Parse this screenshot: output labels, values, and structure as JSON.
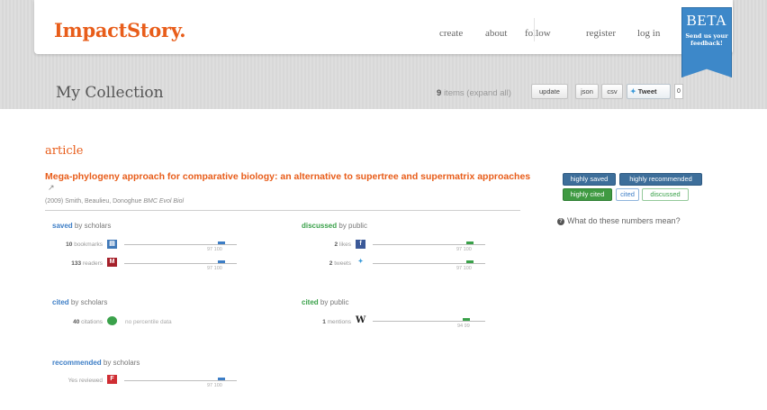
{
  "colors": {
    "accent": "#e85d1a",
    "scholars": "#3d7ec6",
    "public": "#3aa14a",
    "beta": "#3d88c9"
  },
  "header": {
    "logo": "ImpactStory.",
    "nav": [
      "create",
      "about",
      "follow",
      "register",
      "log in"
    ],
    "beta": {
      "title": "BETA",
      "line1": "Send us your",
      "line2": "feedback!"
    }
  },
  "collection": {
    "title": "My Collection",
    "count": "9",
    "count_suffix": "items (expand all)",
    "buttons": {
      "update": "update",
      "json": "json",
      "csv": "csv",
      "tweet": "Tweet",
      "tweet_count": "0"
    }
  },
  "section": "article",
  "article": {
    "title": "Mega-phylogeny approach for comparative biology: an alternative to supertree and supermatrix approaches",
    "year": "(2009)",
    "authors": "Smith, Beaulieu, Donoghue",
    "journal": "BMC Evol Biol"
  },
  "groups": {
    "saved_scholars": {
      "key": "saved",
      "by": "by scholars",
      "metrics": [
        {
          "value": "10",
          "label": "bookmarks",
          "icon": "citeulike-icon",
          "percentile": 97,
          "nums": "97  100"
        },
        {
          "value": "133",
          "label": "readers",
          "icon": "mendeley-icon",
          "percentile": 97,
          "nums": "97  100"
        }
      ]
    },
    "discussed_public": {
      "key": "discussed",
      "by": "by public",
      "metrics": [
        {
          "value": "2",
          "label": "likes",
          "icon": "facebook-icon",
          "percentile": 97,
          "nums": "97  100"
        },
        {
          "value": "2",
          "label": "tweets",
          "icon": "twitter-icon",
          "percentile": 97,
          "nums": "97  100"
        }
      ]
    },
    "cited_scholars": {
      "key": "cited",
      "by": "by scholars",
      "metrics": [
        {
          "value": "40",
          "label": "citations",
          "icon": "pubmed-central-icon",
          "note": "no percentile data"
        }
      ]
    },
    "cited_public": {
      "key": "cited",
      "by": "by public",
      "metrics": [
        {
          "value": "1",
          "label": "mentions",
          "icon": "wikipedia-icon",
          "percentile": 94,
          "nums": "94  99"
        }
      ]
    },
    "recommended_scholars": {
      "key": "recommended",
      "by": "by scholars",
      "metrics": [
        {
          "value": "Yes",
          "label": "reviewed",
          "icon": "f1000-icon",
          "percentile": 97,
          "nums": "97  100"
        }
      ]
    }
  },
  "badges": [
    "highly saved",
    "highly recommended",
    "highly cited",
    "cited",
    "discussed"
  ],
  "help": "What do these numbers mean?"
}
